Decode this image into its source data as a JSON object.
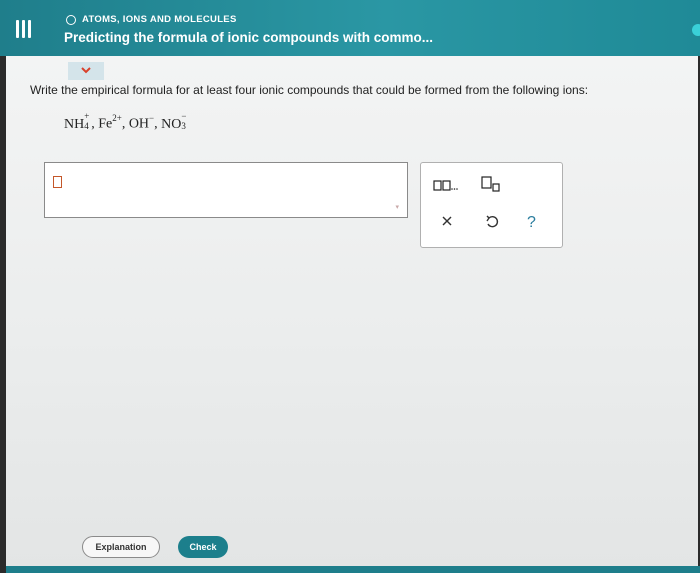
{
  "header": {
    "topic": "ATOMS, IONS AND MOLECULES",
    "title": "Predicting the formula of ionic compounds with commo...",
    "menu_icon": "menu-icon"
  },
  "question": {
    "prompt": "Write the empirical formula for at least four ionic compounds that could be formed from the following ions:",
    "ions": [
      {
        "base": "NH",
        "sub": "4",
        "sup": "+"
      },
      {
        "base": "Fe",
        "sub": "",
        "sup": "2+"
      },
      {
        "base": "OH",
        "sub": "",
        "sup": "−"
      },
      {
        "base": "NO",
        "sub": "3",
        "sup": "−"
      }
    ],
    "separator": ","
  },
  "answer": {
    "value": ""
  },
  "palette": {
    "buttons": [
      "two-box-icon",
      "subscript-icon",
      "clear-icon",
      "undo-icon",
      "help-icon"
    ],
    "help_label": "?"
  },
  "footer": {
    "explanation_label": "Explanation",
    "check_label": "Check"
  },
  "colors": {
    "header": "#2a8f9b",
    "accent": "#1c7f8c",
    "cursor": "#c4572a"
  }
}
